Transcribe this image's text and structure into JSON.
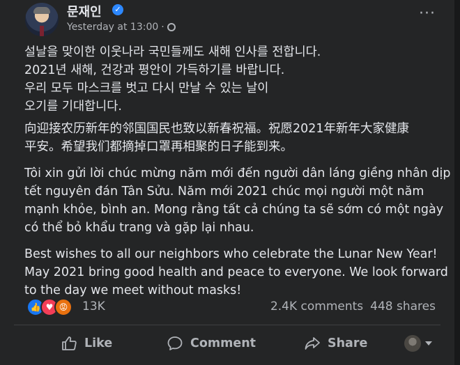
{
  "post": {
    "author": "문재인",
    "timestamp": "Yesterday at 13:00",
    "dot": "·",
    "more_glyph": "···",
    "paragraphs": {
      "korean": "설날을 맞이한 이웃나라 국민들께도 새해 인사를 전합니다.\n2021년 새해, 건강과 평안이 가득하기를 바랍니다.\n우리 모두 마스크를 벗고 다시 만날 수 있는 날이\n오기를 기대합니다.",
      "chinese": "向迎接农历新年的邻国国民也致以新春祝福。祝愿2021年新年大家健康\n平安。希望我们都摘掉口罩再相聚的日子能到来。",
      "vietnamese": "Tôi xin gửi lời chúc mừng năm mới đến người dân láng giềng nhân dịp\ntết nguyên đán Tân Sửu. Năm mới 2021 chúc mọi người một năm\nmạnh khỏe, bình an. Mong rằng tất cả chúng ta sẽ sớm có một ngày\ncó thể bỏ khẩu trang và gặp lại nhau.",
      "english": "Best wishes to all our neighbors who celebrate the Lunar New Year!\nMay 2021 bring good health and peace to everyone. We look forward\nto the day we meet without masks!"
    }
  },
  "stats": {
    "reactions_count": "13K",
    "comments": "2.4K comments",
    "shares": "448 shares",
    "reaction_icons": [
      "like-reaction",
      "love-reaction",
      "angry-reaction"
    ]
  },
  "actions": {
    "like": "Like",
    "comment": "Comment",
    "share": "Share"
  },
  "colors": {
    "background": "#242526",
    "text": "#e4e6eb",
    "secondary": "#b0b3b8",
    "verified": "#2d88ff"
  }
}
